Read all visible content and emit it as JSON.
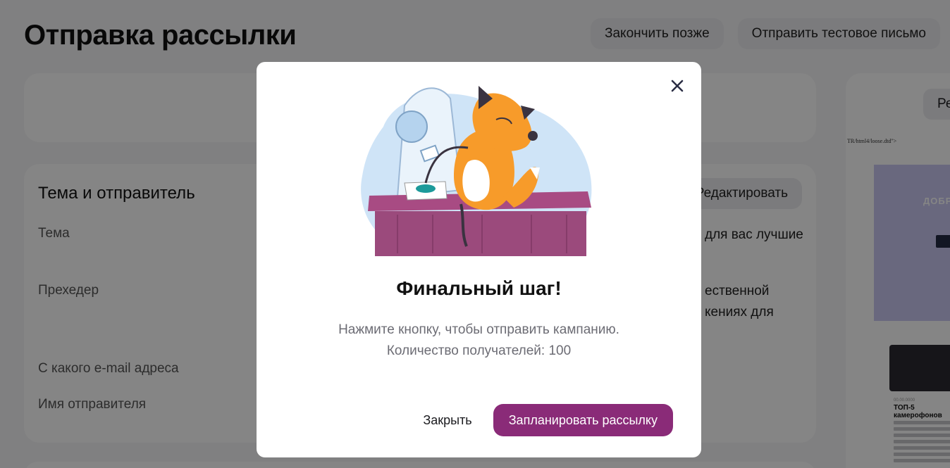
{
  "page": {
    "title": "Отправка рассылки",
    "finish_later": "Закончить позже",
    "send_test": "Отправить тестовое письмо"
  },
  "section": {
    "title": "Тема и отправитель",
    "edit": "Редактировать",
    "labels": {
      "subject": "Тема",
      "preheader": "Прехедер",
      "from_email": "С какого e-mail адреса",
      "sender_name": "Имя отправителя"
    },
    "values": {
      "subject_fragment": "для вас лучшие",
      "preheader_line1": "ественной",
      "preheader_line2": "кениях для"
    }
  },
  "preview": {
    "side_button": "Ре",
    "doctype": "TR/html4/loose.dtd\">",
    "banner_text": "ДОБР",
    "article_date": "00.00.0000",
    "article_heading": "ТОП-5 камерофонов"
  },
  "modal": {
    "title": "Финальный шаг!",
    "text_line1": "Нажмите кнопку, чтобы отправить кампанию.",
    "text_line2": "Количество получателей: 100",
    "close_label": "Закрыть",
    "schedule_label": "Запланировать рассылку",
    "accent_color": "#8a2b78"
  }
}
